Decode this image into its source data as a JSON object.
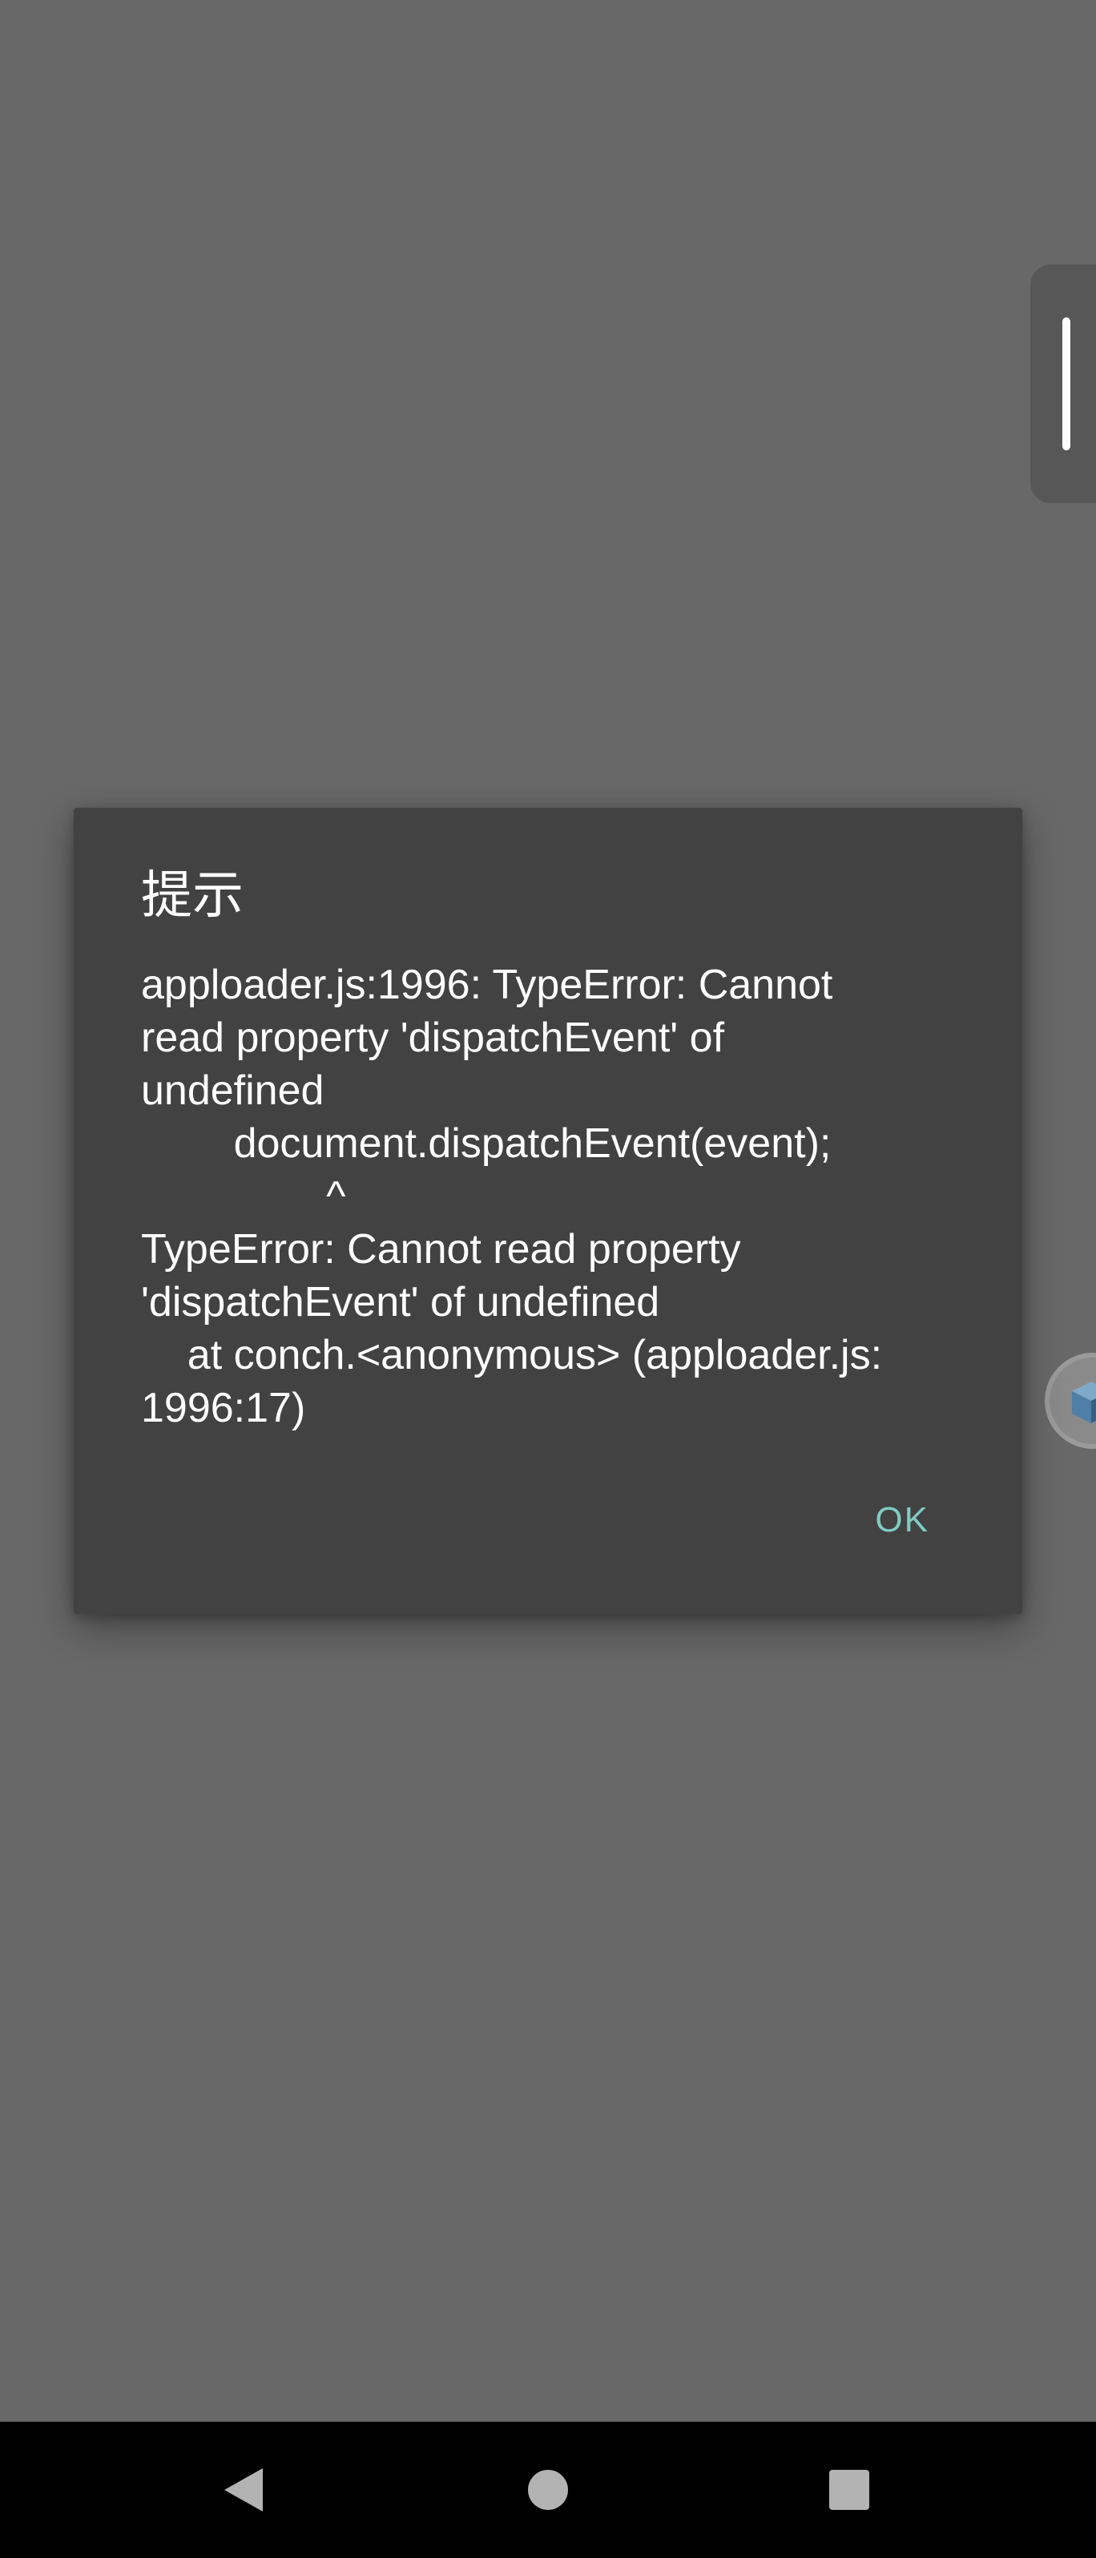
{
  "dialog": {
    "title": "提示",
    "message": "apploader.js:1996: TypeError: Cannot\nread property 'dispatchEvent' of\nundefined\n        document.dispatchEvent(event);\n                ^\nTypeError: Cannot read property\n'dispatchEvent' of undefined\n    at conch.<anonymous> (apploader.js:\n1996:17)",
    "ok_label": "OK"
  },
  "icons": {
    "edge_tab": "drag-handle-icon",
    "float_ball": "cube-icon",
    "nav_back": "back-triangle-icon",
    "nav_home": "home-circle-icon",
    "nav_recent": "recent-square-icon"
  },
  "colors": {
    "background": "#686868",
    "dialog": "#424242",
    "accent": "#80cbc4",
    "nav_bar": "#000000"
  }
}
